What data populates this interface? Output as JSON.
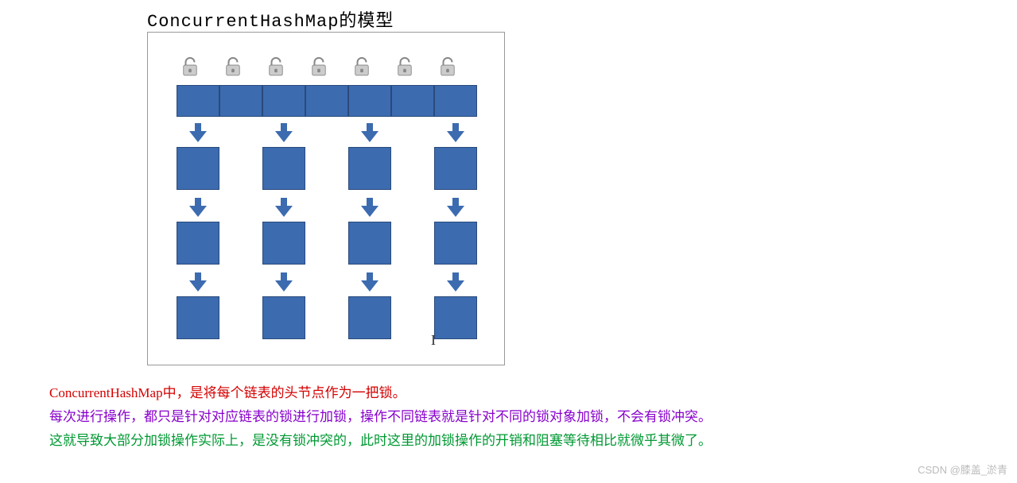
{
  "title": "ConcurrentHashMap的模型",
  "diagram": {
    "lock_count": 7,
    "bucket_count": 7,
    "chain_columns": [
      0,
      2,
      4,
      6
    ],
    "nodes_per_chain": 3
  },
  "text": {
    "line1": "ConcurrentHashMap中，是将每个链表的头节点作为一把锁。",
    "line2": "每次进行操作，都只是针对对应链表的锁进行加锁，操作不同链表就是针对不同的锁对象加锁，不会有锁冲突。",
    "line3": "这就导致大部分加锁操作实际上，是没有锁冲突的，此时这里的加锁操作的开销和阻塞等待相比就微乎其微了。"
  },
  "watermark": "CSDN @膝盖_淤青",
  "cursor": "I",
  "colors": {
    "block": "#3c6bb0",
    "red": "#d40000",
    "purple": "#8800cc",
    "green": "#009933"
  }
}
